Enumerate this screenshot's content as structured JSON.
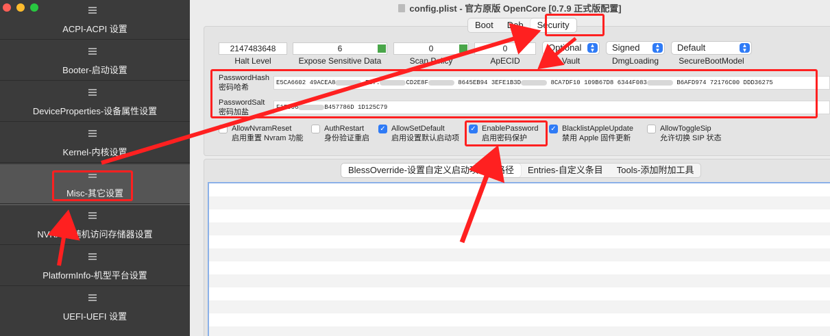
{
  "window": {
    "title": "config.plist - 官方原版 OpenCore [0.7.9 正式版配置]"
  },
  "sidebar": {
    "items": [
      {
        "label": "ACPI-ACPI 设置"
      },
      {
        "label": "Booter-启动设置"
      },
      {
        "label": "DeviceProperties-设备属性设置"
      },
      {
        "label": "Kernel-内核设置"
      },
      {
        "label": "Misc-其它设置"
      },
      {
        "label": "NVRAM-随机访问存储器设置"
      },
      {
        "label": "PlatformInfo-机型平台设置"
      },
      {
        "label": "UEFI-UEFI 设置"
      }
    ]
  },
  "tabs_top": [
    "Boot",
    "Deb",
    "Security"
  ],
  "security": {
    "halt_level": {
      "value": "2147483648",
      "label": "Halt Level"
    },
    "expose_sensitive": {
      "value": "6",
      "label": "Expose Sensitive Data"
    },
    "scan_policy": {
      "value": "0",
      "label": "Scan Policy"
    },
    "apecid": {
      "value": "0",
      "label": "ApECID"
    },
    "vault": {
      "value": "Optional",
      "label": "Vault"
    },
    "dmg_loading": {
      "value": "Signed",
      "label": "DmgLoading"
    },
    "secure_boot_model": {
      "value": "Default",
      "label": "SecureBootModel"
    },
    "password_hash": {
      "label": "PasswordHash",
      "label_cn": "密码哈希",
      "value_parts": [
        "E5CA6602 49ACEA8",
        "F87.",
        "CD2E8F",
        "8645EB94 3EFE1B3D",
        "8CA7DF10 109B67D8 6344F083",
        "B6AFD974 72176C00 DDD36275"
      ]
    },
    "password_salt": {
      "label": "PasswordSalt",
      "label_cn": "密码加盐",
      "value_parts": [
        "F15D06",
        "B457786D 1D125C79"
      ]
    }
  },
  "checkboxes": [
    {
      "label": "AllowNvramReset",
      "sub": "启用重置 Nvram 功能",
      "checked": false
    },
    {
      "label": "AuthRestart",
      "sub": "身份验证重启",
      "checked": false
    },
    {
      "label": "AllowSetDefault",
      "sub": "启用设置默认启动项",
      "checked": true
    },
    {
      "label": "EnablePassword",
      "sub": "启用密码保护",
      "checked": true
    },
    {
      "label": "BlacklistAppleUpdate",
      "sub": "禁用 Apple 固件更新",
      "checked": true
    },
    {
      "label": "AllowToggleSip",
      "sub": "允许切换 SIP 状态",
      "checked": false
    }
  ],
  "tabs_bottom": [
    "BlessOverride-设置自定义启动项绝对路径",
    "Entries-自定义条目",
    "Tools-添加附加工具"
  ],
  "colors": {
    "highlight": "#ff2020",
    "accent": "#2f7bf6",
    "sidebar": "#3b3b3b"
  }
}
